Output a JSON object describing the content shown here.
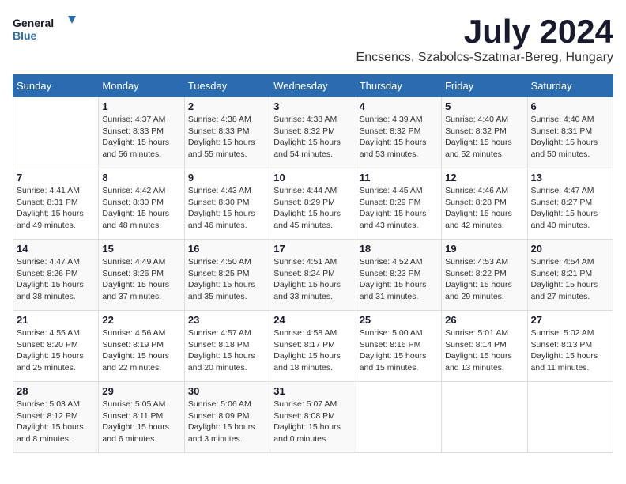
{
  "logo": {
    "line1": "General",
    "line2": "Blue"
  },
  "title": "July 2024",
  "location": "Encsencs, Szabolcs-Szatmar-Bereg, Hungary",
  "days_header": [
    "Sunday",
    "Monday",
    "Tuesday",
    "Wednesday",
    "Thursday",
    "Friday",
    "Saturday"
  ],
  "weeks": [
    [
      {
        "day": "",
        "info": ""
      },
      {
        "day": "1",
        "info": "Sunrise: 4:37 AM\nSunset: 8:33 PM\nDaylight: 15 hours\nand 56 minutes."
      },
      {
        "day": "2",
        "info": "Sunrise: 4:38 AM\nSunset: 8:33 PM\nDaylight: 15 hours\nand 55 minutes."
      },
      {
        "day": "3",
        "info": "Sunrise: 4:38 AM\nSunset: 8:32 PM\nDaylight: 15 hours\nand 54 minutes."
      },
      {
        "day": "4",
        "info": "Sunrise: 4:39 AM\nSunset: 8:32 PM\nDaylight: 15 hours\nand 53 minutes."
      },
      {
        "day": "5",
        "info": "Sunrise: 4:40 AM\nSunset: 8:32 PM\nDaylight: 15 hours\nand 52 minutes."
      },
      {
        "day": "6",
        "info": "Sunrise: 4:40 AM\nSunset: 8:31 PM\nDaylight: 15 hours\nand 50 minutes."
      }
    ],
    [
      {
        "day": "7",
        "info": "Sunrise: 4:41 AM\nSunset: 8:31 PM\nDaylight: 15 hours\nand 49 minutes."
      },
      {
        "day": "8",
        "info": "Sunrise: 4:42 AM\nSunset: 8:30 PM\nDaylight: 15 hours\nand 48 minutes."
      },
      {
        "day": "9",
        "info": "Sunrise: 4:43 AM\nSunset: 8:30 PM\nDaylight: 15 hours\nand 46 minutes."
      },
      {
        "day": "10",
        "info": "Sunrise: 4:44 AM\nSunset: 8:29 PM\nDaylight: 15 hours\nand 45 minutes."
      },
      {
        "day": "11",
        "info": "Sunrise: 4:45 AM\nSunset: 8:29 PM\nDaylight: 15 hours\nand 43 minutes."
      },
      {
        "day": "12",
        "info": "Sunrise: 4:46 AM\nSunset: 8:28 PM\nDaylight: 15 hours\nand 42 minutes."
      },
      {
        "day": "13",
        "info": "Sunrise: 4:47 AM\nSunset: 8:27 PM\nDaylight: 15 hours\nand 40 minutes."
      }
    ],
    [
      {
        "day": "14",
        "info": "Sunrise: 4:47 AM\nSunset: 8:26 PM\nDaylight: 15 hours\nand 38 minutes."
      },
      {
        "day": "15",
        "info": "Sunrise: 4:49 AM\nSunset: 8:26 PM\nDaylight: 15 hours\nand 37 minutes."
      },
      {
        "day": "16",
        "info": "Sunrise: 4:50 AM\nSunset: 8:25 PM\nDaylight: 15 hours\nand 35 minutes."
      },
      {
        "day": "17",
        "info": "Sunrise: 4:51 AM\nSunset: 8:24 PM\nDaylight: 15 hours\nand 33 minutes."
      },
      {
        "day": "18",
        "info": "Sunrise: 4:52 AM\nSunset: 8:23 PM\nDaylight: 15 hours\nand 31 minutes."
      },
      {
        "day": "19",
        "info": "Sunrise: 4:53 AM\nSunset: 8:22 PM\nDaylight: 15 hours\nand 29 minutes."
      },
      {
        "day": "20",
        "info": "Sunrise: 4:54 AM\nSunset: 8:21 PM\nDaylight: 15 hours\nand 27 minutes."
      }
    ],
    [
      {
        "day": "21",
        "info": "Sunrise: 4:55 AM\nSunset: 8:20 PM\nDaylight: 15 hours\nand 25 minutes."
      },
      {
        "day": "22",
        "info": "Sunrise: 4:56 AM\nSunset: 8:19 PM\nDaylight: 15 hours\nand 22 minutes."
      },
      {
        "day": "23",
        "info": "Sunrise: 4:57 AM\nSunset: 8:18 PM\nDaylight: 15 hours\nand 20 minutes."
      },
      {
        "day": "24",
        "info": "Sunrise: 4:58 AM\nSunset: 8:17 PM\nDaylight: 15 hours\nand 18 minutes."
      },
      {
        "day": "25",
        "info": "Sunrise: 5:00 AM\nSunset: 8:16 PM\nDaylight: 15 hours\nand 15 minutes."
      },
      {
        "day": "26",
        "info": "Sunrise: 5:01 AM\nSunset: 8:14 PM\nDaylight: 15 hours\nand 13 minutes."
      },
      {
        "day": "27",
        "info": "Sunrise: 5:02 AM\nSunset: 8:13 PM\nDaylight: 15 hours\nand 11 minutes."
      }
    ],
    [
      {
        "day": "28",
        "info": "Sunrise: 5:03 AM\nSunset: 8:12 PM\nDaylight: 15 hours\nand 8 minutes."
      },
      {
        "day": "29",
        "info": "Sunrise: 5:05 AM\nSunset: 8:11 PM\nDaylight: 15 hours\nand 6 minutes."
      },
      {
        "day": "30",
        "info": "Sunrise: 5:06 AM\nSunset: 8:09 PM\nDaylight: 15 hours\nand 3 minutes."
      },
      {
        "day": "31",
        "info": "Sunrise: 5:07 AM\nSunset: 8:08 PM\nDaylight: 15 hours\nand 0 minutes."
      },
      {
        "day": "",
        "info": ""
      },
      {
        "day": "",
        "info": ""
      },
      {
        "day": "",
        "info": ""
      }
    ]
  ]
}
